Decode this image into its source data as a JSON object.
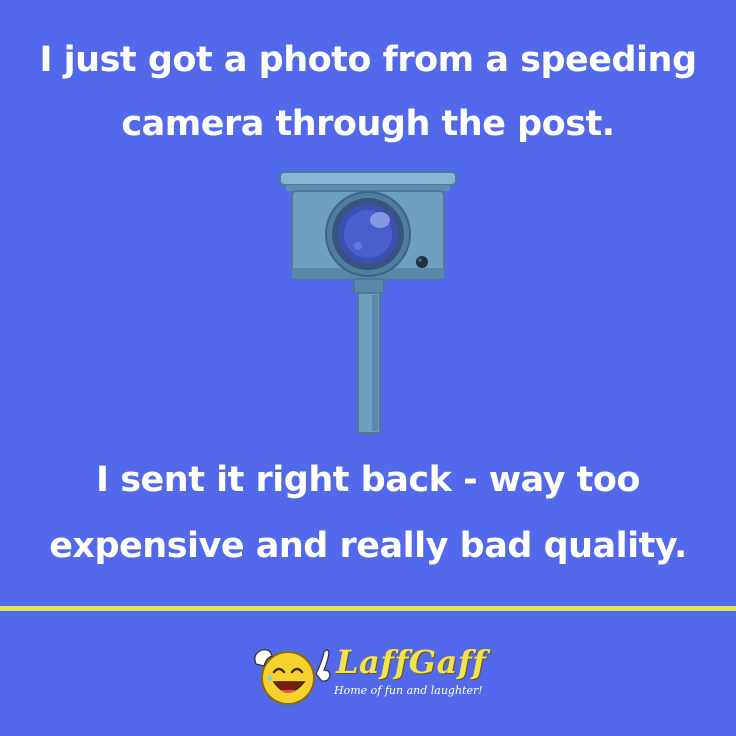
{
  "joke": {
    "setup_line_1": "I just got a photo from a speeding",
    "setup_line_2": "camera through the post.",
    "punchline_line_1": "I sent it right back - way too",
    "punchline_line_2": "expensive and really bad quality."
  },
  "brand": {
    "name": "LaffGaff",
    "tagline": "Home of fun and laughter!"
  },
  "illustration": {
    "subject": "speed-camera-icon"
  },
  "colors": {
    "background": "#5169ea",
    "text": "#ffffff",
    "divider": "#e3e35a",
    "brand_name": "#f2e24e",
    "camera_body": "#6d9fbf",
    "camera_lens": "#3d4fb0"
  }
}
